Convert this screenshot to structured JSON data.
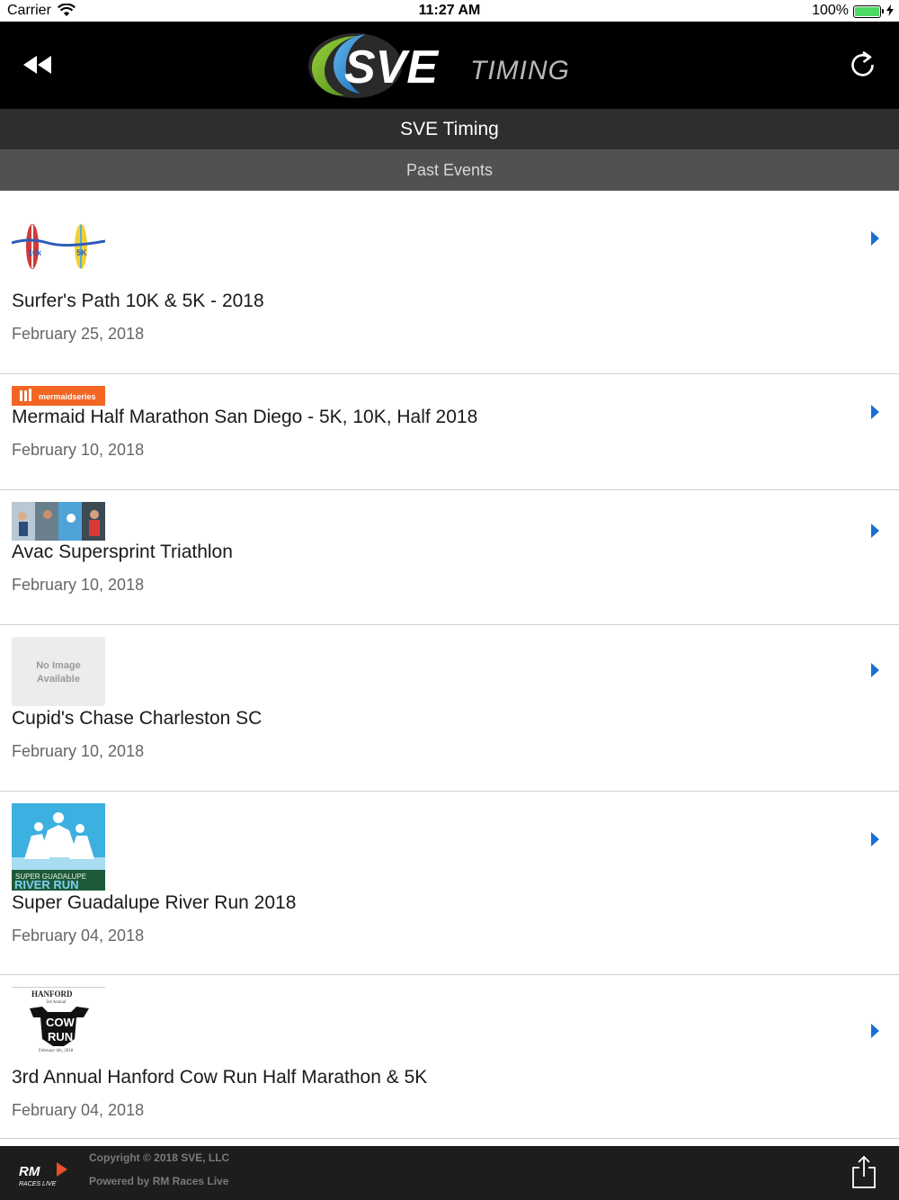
{
  "status_bar": {
    "carrier": "Carrier",
    "time": "11:27 AM",
    "battery_percent": "100%"
  },
  "header": {
    "logo_text_main": "SVE",
    "logo_text_sub": "TIMING",
    "rewind_icon": "rewind-icon",
    "refresh_icon": "refresh-icon"
  },
  "title_bar": {
    "title": "SVE Timing"
  },
  "sub_bar": {
    "label": "Past Events"
  },
  "events": [
    {
      "title": "Surfer's Path 10K & 5K - 2018",
      "date": "February 25, 2018",
      "thumb": "surfboards",
      "thumb_text": [
        "10k",
        "5K"
      ]
    },
    {
      "title": "Mermaid Half Marathon San Diego - 5K, 10K, Half 2018",
      "date": "February 10, 2018",
      "thumb": "mermaid",
      "thumb_text": [
        "mermaidseries"
      ]
    },
    {
      "title": "Avac Supersprint Triathlon",
      "date": "February 10, 2018",
      "thumb": "photos",
      "thumb_text": []
    },
    {
      "title": "Cupid's Chase Charleston SC",
      "date": "February 10, 2018",
      "thumb": "no-image",
      "thumb_text": [
        "No Image",
        "Available"
      ]
    },
    {
      "title": "Super Guadalupe River Run 2018",
      "date": "February 04, 2018",
      "thumb": "river-run",
      "thumb_text": [
        "SUPER GUADALUPE",
        "RIVER RUN"
      ]
    },
    {
      "title": "3rd Annual Hanford Cow Run Half Marathon & 5K",
      "date": "February 04, 2018",
      "thumb": "cow-run",
      "thumb_text": [
        "HANFORD",
        "3rd Annual",
        "COW",
        "RUN",
        "February 4th, 2018"
      ]
    }
  ],
  "footer": {
    "logo_text": "RM",
    "logo_sub": "RACES LIVE",
    "copyright": "Copyright © 2018 SVE, LLC",
    "powered": "Powered by RM Races Live"
  },
  "colors": {
    "header_bg": "#000000",
    "title_bar_bg": "#2e2e2e",
    "sub_bar_bg": "#515151",
    "chevron": "#1a6fd6",
    "footer_bg": "#1d1d1d",
    "battery": "#4cd964"
  }
}
